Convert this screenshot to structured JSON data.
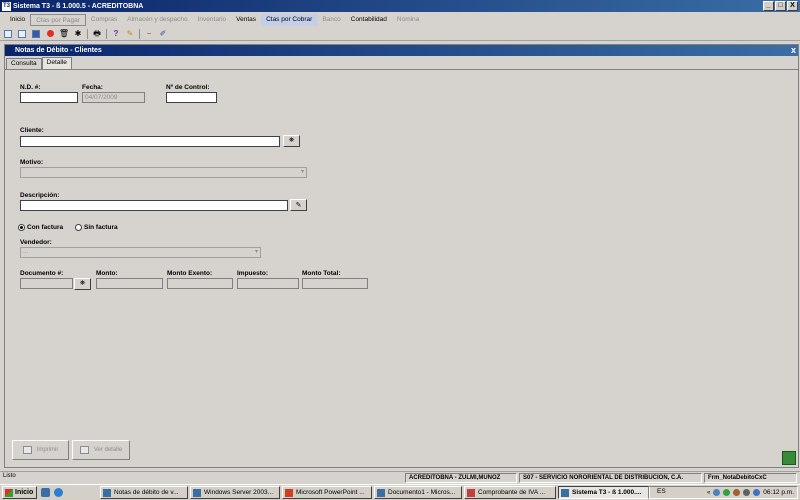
{
  "window": {
    "title": "Sistema T3 - ß 1.000.5 - ACREDITOBNA",
    "controls": [
      "_",
      "□",
      "X"
    ]
  },
  "menu": [
    {
      "label": "Inicio",
      "state": "normal"
    },
    {
      "label": "Ctas por Pagar",
      "state": "boxed"
    },
    {
      "label": "Compras",
      "state": "disabled"
    },
    {
      "label": "Almacén y despacho",
      "state": "disabled"
    },
    {
      "label": "Inventario",
      "state": "disabled"
    },
    {
      "label": "Ventas",
      "state": "normal"
    },
    {
      "label": "Ctas por Cobrar",
      "state": "hl"
    },
    {
      "label": "Banco",
      "state": "disabled"
    },
    {
      "label": "Contabilidad",
      "state": "normal"
    },
    {
      "label": "Nómina",
      "state": "disabled"
    }
  ],
  "child_window": {
    "title": "Notas de Débito - Clientes",
    "close": "x"
  },
  "tabs": {
    "consulta": "Consulta",
    "detalle": "Detalle"
  },
  "form": {
    "nd_label": "N.D. #:",
    "nd_value": "",
    "fecha_label": "Fecha:",
    "fecha_value": "04/07/2009",
    "control_label": "Nº de Control:",
    "control_value": "",
    "cliente_label": "Cliente:",
    "cliente_value": "",
    "motivo_label": "Motivo:",
    "motivo_value": "",
    "descripcion_label": "Descripción:",
    "descripcion_value": "",
    "con_factura": "Con factura",
    "sin_factura": "Sin factura",
    "vendedor_label": "Vendedor:",
    "vendedor_value": "...",
    "documento_label": "Documento #:",
    "monto_label": "Monto:",
    "monto_exento_label": "Monto Exento:",
    "impuesto_label": "Impuesto:",
    "monto_total_label": "Monto Total:"
  },
  "actions": {
    "imprimir": "Imprimir",
    "ver_detalle": "Ver detalle"
  },
  "statusbar": {
    "left": "Listo",
    "panel1": "ACREDITOBNA - ZULMI,MUÑOZ",
    "panel2": "S07 - SERVICIO NORORIENTAL DE DISTRIBUCIÓN, C.A.",
    "panel3": "Frm_NotaDebitoCxC"
  },
  "taskbar": {
    "start": "Inicio",
    "tasks": [
      "Notas de débito de v...",
      "Windows Server 2003...",
      "Microsoft PowerPoint ...",
      "Documento1 - Micros...",
      "Comprobante de IVA ...",
      "Sistema T3 - ß 1.000...."
    ],
    "lang": "ES",
    "clock": "06:12 p.m."
  }
}
